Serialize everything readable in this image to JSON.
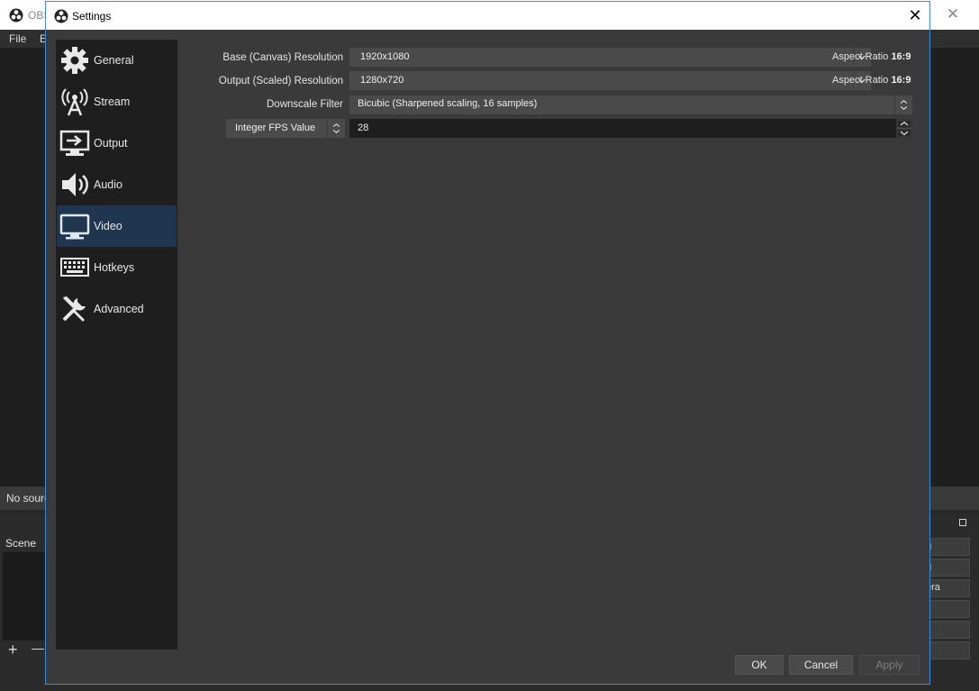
{
  "background_window": {
    "title": "OBS",
    "menu": [
      "File",
      "E"
    ],
    "no_source_text": "No sourc",
    "scene_header": "Scene",
    "scene_add": "+",
    "scene_remove": "—",
    "right_buttons": [
      "g",
      "g",
      "era",
      "",
      "",
      ""
    ]
  },
  "dialog": {
    "title": "Settings"
  },
  "sidebar": {
    "items": [
      {
        "label": "General",
        "icon": "gear-icon",
        "active": false
      },
      {
        "label": "Stream",
        "icon": "antenna-icon",
        "active": false
      },
      {
        "label": "Output",
        "icon": "output-monitor-icon",
        "active": false
      },
      {
        "label": "Audio",
        "icon": "speaker-icon",
        "active": false
      },
      {
        "label": "Video",
        "icon": "monitor-icon",
        "active": true
      },
      {
        "label": "Hotkeys",
        "icon": "keyboard-icon",
        "active": false
      },
      {
        "label": "Advanced",
        "icon": "wrench-screwdriver-icon",
        "active": false
      }
    ]
  },
  "video": {
    "base_label": "Base (Canvas) Resolution",
    "base_value": "1920x1080",
    "base_aspect_label": "Aspect Ratio",
    "base_aspect_value": "16:9",
    "output_label": "Output (Scaled) Resolution",
    "output_value": "1280x720",
    "output_aspect_label": "Aspect Ratio",
    "output_aspect_value": "16:9",
    "downscale_label": "Downscale Filter",
    "downscale_value": "Bicubic (Sharpened scaling, 16 samples)",
    "fps_type_value": "Integer FPS Value",
    "fps_value": "28"
  },
  "buttons": {
    "ok": "OK",
    "cancel": "Cancel",
    "apply": "Apply"
  },
  "colors": {
    "accent_active": "#1f3550",
    "dialog_border": "#3c8dd9"
  }
}
